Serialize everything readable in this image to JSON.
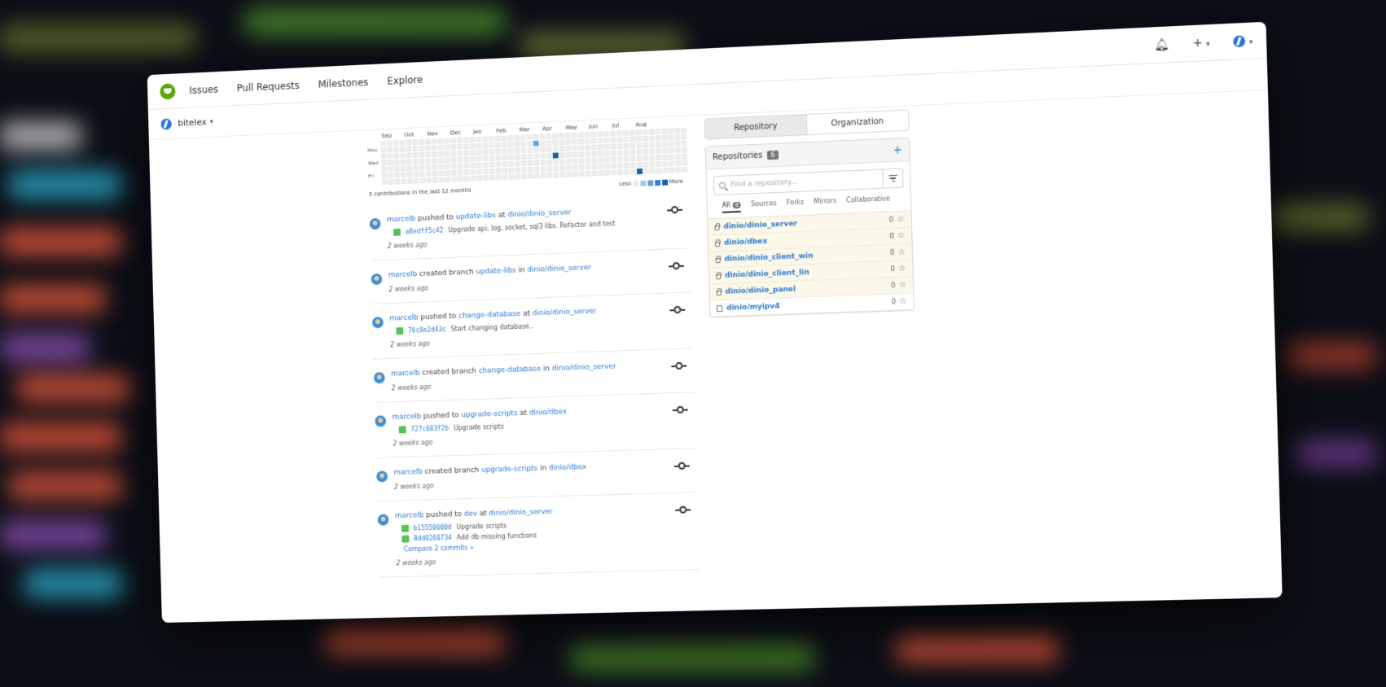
{
  "nav": {
    "links": [
      "Issues",
      "Pull Requests",
      "Milestones",
      "Explore"
    ],
    "notifications_icon": "bell-icon",
    "create_label": "+"
  },
  "context": {
    "org_name": "bitelex"
  },
  "heatmap": {
    "months": [
      "Sep",
      "Oct",
      "Nov",
      "Dec",
      "Jan",
      "Feb",
      "Mar",
      "Apr",
      "May",
      "Jun",
      "Jul",
      "Aug"
    ],
    "days": [
      "Mon",
      "Wed",
      "Fri"
    ],
    "summary": "5 contributions in the last 12 months",
    "legend_less": "Less",
    "legend_more": "More",
    "active_weeks": [
      {
        "week": 24,
        "day": 1,
        "level": 1
      },
      {
        "week": 27,
        "day": 3,
        "level": 3
      },
      {
        "week": 40,
        "day": 6,
        "level": 3
      }
    ]
  },
  "feed": [
    {
      "user": "marcelb",
      "action": "pushed to",
      "branch": "update-libs",
      "prep": "at",
      "repo": "dinio/dinio_server",
      "commits": [
        {
          "sha": "a8edff5c42",
          "msg": "Upgrade api, log, socket, sql3 libs. Refactor and test"
        }
      ],
      "compare": "",
      "time": "2 weeks ago"
    },
    {
      "user": "marcelb",
      "action": "created branch",
      "branch": "update-libs",
      "prep": "in",
      "repo": "dinio/dinio_server",
      "commits": [],
      "compare": "",
      "time": "2 weeks ago"
    },
    {
      "user": "marcelb",
      "action": "pushed to",
      "branch": "change-database",
      "prep": "at",
      "repo": "dinio/dinio_server",
      "commits": [
        {
          "sha": "76c8e2d43c",
          "msg": "Start changing database.."
        }
      ],
      "compare": "",
      "time": "2 weeks ago"
    },
    {
      "user": "marcelb",
      "action": "created branch",
      "branch": "change-database",
      "prep": "in",
      "repo": "dinio/dinio_server",
      "commits": [],
      "compare": "",
      "time": "2 weeks ago"
    },
    {
      "user": "marcelb",
      "action": "pushed to",
      "branch": "upgrade-scripts",
      "prep": "at",
      "repo": "dinio/dbex",
      "commits": [
        {
          "sha": "727c603f2b",
          "msg": "Upgrade scripts"
        }
      ],
      "compare": "",
      "time": "2 weeks ago"
    },
    {
      "user": "marcelb",
      "action": "created branch",
      "branch": "upgrade-scripts",
      "prep": "in",
      "repo": "dinio/dbex",
      "commits": [],
      "compare": "",
      "time": "2 weeks ago"
    },
    {
      "user": "marcelb",
      "action": "pushed to",
      "branch": "dev",
      "prep": "at",
      "repo": "dinio/dinio_server",
      "commits": [
        {
          "sha": "b15550600d",
          "msg": "Upgrade scripts"
        },
        {
          "sha": "8dd0260734",
          "msg": "Add db missing functions"
        }
      ],
      "compare": "Compare 2 commits »",
      "time": "2 weeks ago"
    }
  ],
  "sidebar": {
    "tabs": [
      "Repository",
      "Organization"
    ],
    "title": "Repositories",
    "count": "6",
    "add_label": "+",
    "search_placeholder": "Find a repository...",
    "filters": [
      "All",
      "Sources",
      "Forks",
      "Mirrors",
      "Collaborative"
    ],
    "all_count": "6",
    "repos": [
      {
        "name": "dinio/dinio_server",
        "private": true,
        "stars": "0"
      },
      {
        "name": "dinio/dbex",
        "private": true,
        "stars": "0"
      },
      {
        "name": "dinio/dinio_client_win",
        "private": true,
        "stars": "0"
      },
      {
        "name": "dinio/dinio_client_lin",
        "private": true,
        "stars": "0"
      },
      {
        "name": "dinio/dinio_panel",
        "private": true,
        "stars": "0"
      },
      {
        "name": "dinio/myipv4",
        "private": false,
        "stars": "0"
      }
    ]
  },
  "colors": {
    "link": "#2f7ad1",
    "brand": "#5aa509",
    "private_row": "#fcf8e9"
  }
}
